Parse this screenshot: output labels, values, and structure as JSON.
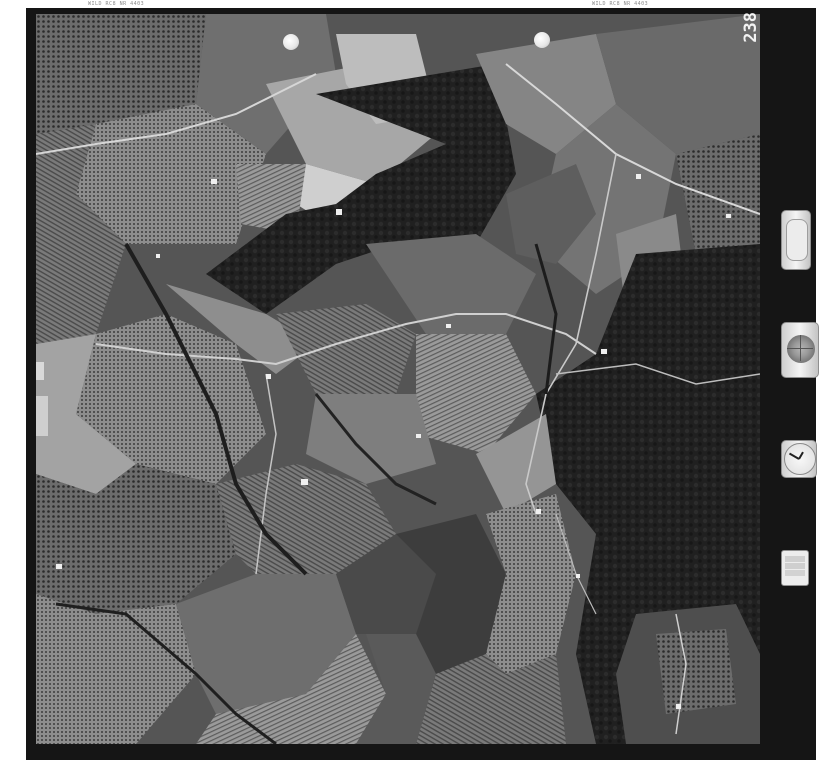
{
  "frame": {
    "number": "238",
    "edge_text_left": "WILD RC8 NR 4403",
    "edge_text_right": "WILD RC8 NR 4403"
  },
  "instruments": {
    "altimeter_icon": "altimeter-gauge",
    "level_icon": "circular-level",
    "clock_icon": "clock",
    "data_card_lines": [
      "",
      "",
      ""
    ]
  },
  "colors": {
    "film_border": "#151515",
    "sheet": "#ffffff"
  }
}
